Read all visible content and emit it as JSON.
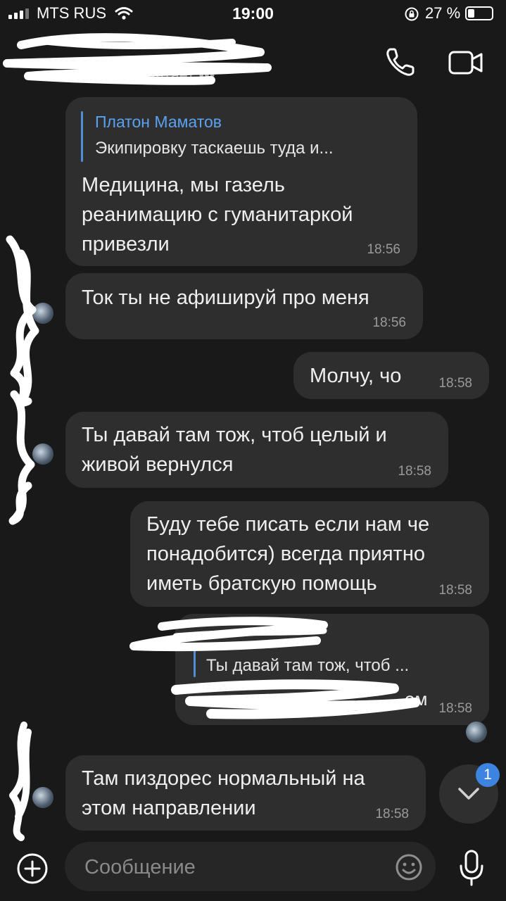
{
  "status_bar": {
    "carrier": "MTS RUS",
    "time": "19:00",
    "battery_percent": "27 %"
  },
  "header": {
    "contact_name": "",
    "status": "печатает •••"
  },
  "messages": [
    {
      "direction": "incoming",
      "reply": {
        "name": "Платон Маматов",
        "text": "Экипировку таскаешь туда и..."
      },
      "lines": [
        "Медицина, мы газель",
        "реанимацию с гуманитаркой",
        "привезли"
      ],
      "time": "18:56"
    },
    {
      "direction": "incoming",
      "lines": [
        "Ток ты не афишируй про меня"
      ],
      "time": "18:56"
    },
    {
      "direction": "outgoing",
      "lines": [
        "Молчу, чо"
      ],
      "time": "18:58"
    },
    {
      "direction": "incoming",
      "lines": [
        "Ты давай там тож, чтоб целый и",
        "живой вернулся"
      ],
      "time": "18:58"
    },
    {
      "direction": "outgoing",
      "lines": [
        "Буду тебе писать если нам че",
        "понадобится) всегда приятно",
        "иметь братскую помощь"
      ],
      "time": "18:58"
    },
    {
      "direction": "outgoing",
      "reply": {
        "name": "",
        "text": "Ты давай там тож, чтоб ..."
      },
      "lines": [
        "…ем"
      ],
      "time": "18:58"
    },
    {
      "direction": "incoming",
      "lines": [
        "Там пиздорес нормальный на",
        "этом направлении"
      ],
      "time": "18:58"
    }
  ],
  "composer": {
    "placeholder": "Сообщение"
  },
  "scroll_down": {
    "unread_count": "1"
  },
  "colors": {
    "background": "#191919",
    "bubble": "#2e2e2f",
    "accent": "#3d83e0",
    "reply_name": "#5aa1ef"
  },
  "icons": [
    "signal-icon",
    "wifi-icon",
    "lock-rotation-icon",
    "battery-icon",
    "phone-icon",
    "video-camera-icon",
    "plus-circle-icon",
    "emoji-icon",
    "microphone-icon",
    "chevron-down-icon"
  ]
}
